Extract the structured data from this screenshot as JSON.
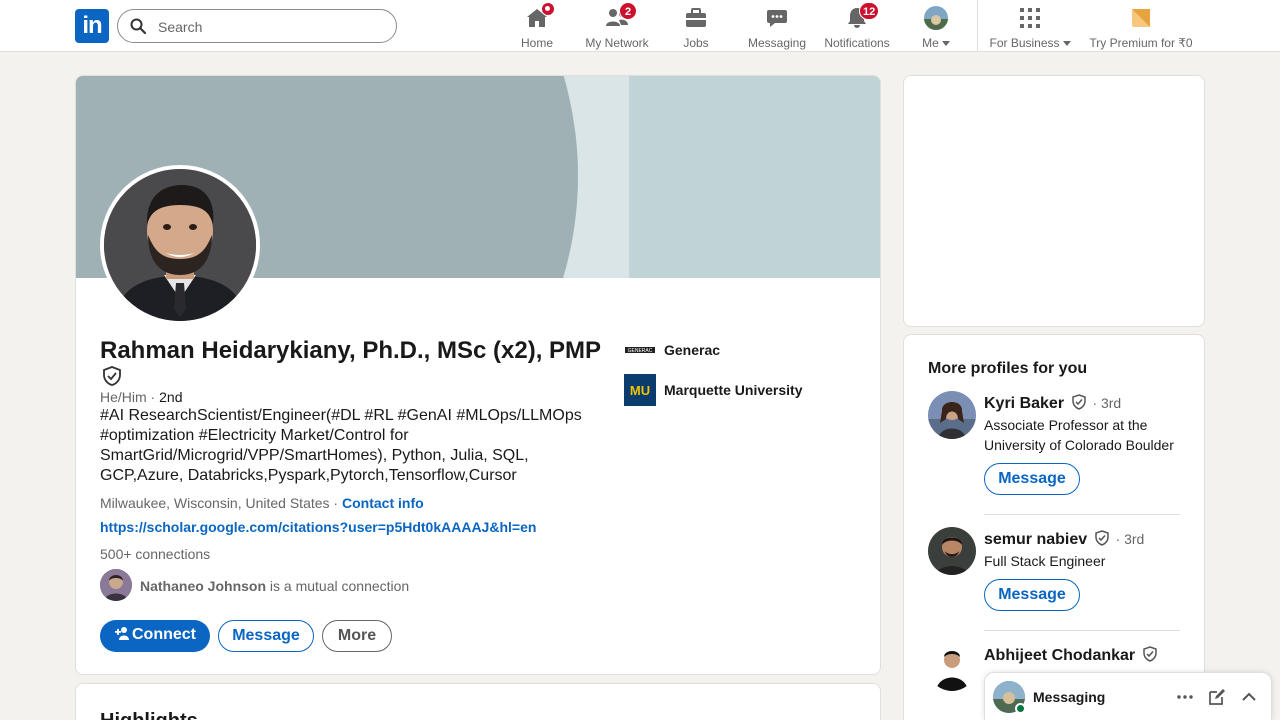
{
  "nav": {
    "logo_text": "in",
    "search_placeholder": "Search",
    "items": [
      {
        "label": "Home",
        "icon": "home-icon",
        "badge": ""
      },
      {
        "label": "My Network",
        "icon": "network-icon",
        "badge": "2"
      },
      {
        "label": "Jobs",
        "icon": "briefcase-icon",
        "badge": ""
      },
      {
        "label": "Messaging",
        "icon": "chat-icon",
        "badge": ""
      },
      {
        "label": "Notifications",
        "icon": "bell-icon",
        "badge": "12"
      },
      {
        "label": "Me",
        "icon": "avatar",
        "badge": ""
      },
      {
        "label": "For Business",
        "icon": "grid-icon",
        "badge": ""
      },
      {
        "label": "Try Premium for ₹0",
        "icon": "premium-icon",
        "badge": ""
      }
    ]
  },
  "profile": {
    "name": "Rahman Heidarykiany, Ph.D., MSc (x2), PMP",
    "pronouns": "He/Him",
    "degree": "2nd",
    "headline": "#AI ResearchScientist/Engineer(#DL #RL #GenAI #MLOps/LLMOps #optimization #Electricity Market/Control for SmartGrid/Microgrid/VPP/SmartHomes), Python, Julia, SQL, GCP,Azure, Databricks,Pyspark,Pytorch,Tensorflow,Cursor",
    "location": "Milwaukee, Wisconsin, United States",
    "contact_link": "Contact info",
    "website": "https://scholar.google.com/citations?user=p5Hdt0kAAAAJ&hl=en",
    "connections": "500+ connections",
    "mutual_name": "Nathaneo Johnson",
    "mutual_text": "is a mutual connection",
    "experience": [
      {
        "name": "Generac",
        "logo_text": "GENERAC"
      },
      {
        "name": "Marquette University",
        "logo_text": "MU"
      }
    ],
    "buttons": {
      "connect": "Connect",
      "message": "Message",
      "more": "More"
    }
  },
  "highlights": {
    "title": "Highlights"
  },
  "more_profiles": {
    "title": "More profiles for you",
    "items": [
      {
        "name": "Kyri Baker",
        "degree": "3rd",
        "subtitle": "Associate Professor at the University of Colorado Boulder",
        "button": "Message"
      },
      {
        "name": "semur nabiev",
        "degree": "3rd",
        "subtitle": "Full Stack Engineer",
        "button": "Message"
      },
      {
        "name": "Abhijeet Chodankar",
        "degree": "",
        "subtitle": "",
        "button": ""
      }
    ]
  },
  "messaging": {
    "title": "Messaging"
  },
  "colors": {
    "brand": "#0a66c2",
    "badge": "#cb112d",
    "online": "#057642"
  }
}
